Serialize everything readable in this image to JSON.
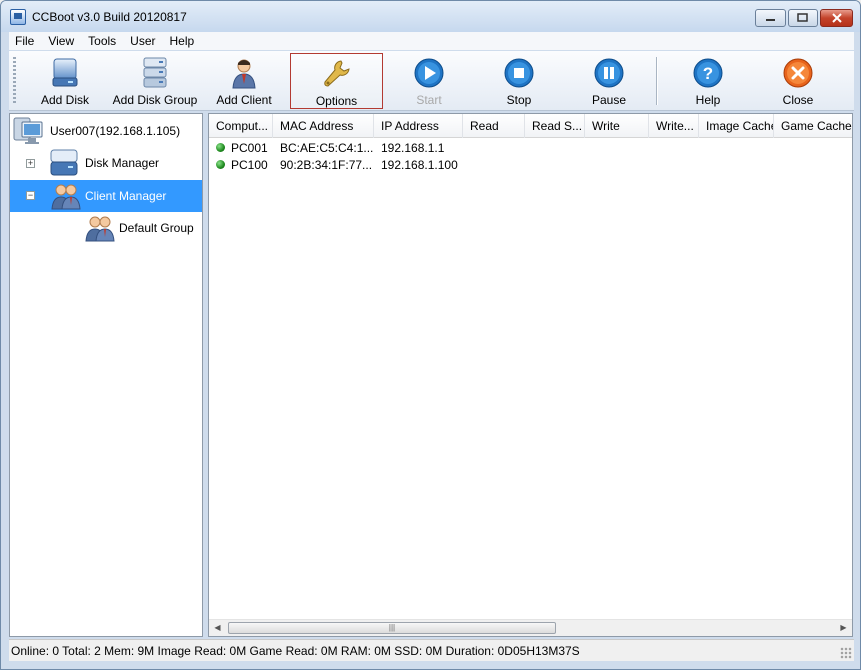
{
  "window": {
    "title": "CCBoot v3.0 Build 20120817"
  },
  "menu": [
    "File",
    "View",
    "Tools",
    "User",
    "Help"
  ],
  "toolbar": {
    "add_disk": "Add Disk",
    "add_disk_group": "Add Disk Group",
    "add_client": "Add Client",
    "options": "Options",
    "start": "Start",
    "stop": "Stop",
    "pause": "Pause",
    "help": "Help",
    "close": "Close"
  },
  "tree": {
    "root": "User007(192.168.1.105)",
    "disk_manager": "Disk Manager",
    "client_manager": "Client Manager",
    "default_group": "Default Group"
  },
  "list": {
    "columns": [
      "Comput...",
      "MAC Address",
      "IP Address",
      "Read",
      "Read S...",
      "Write",
      "Write...",
      "Image Cache",
      "Game Cache"
    ],
    "rows": [
      {
        "computer": "PC001",
        "mac": "BC:AE:C5:C4:1...",
        "ip": "192.168.1.1"
      },
      {
        "computer": "PC100",
        "mac": "90:2B:34:1F:77...",
        "ip": "192.168.1.100"
      }
    ]
  },
  "statusbar": {
    "text": "Online: 0 Total: 2 Mem: 9M Image Read: 0M Game Read: 0M RAM: 0M SSD: 0M Duration: 0D05H13M37S"
  },
  "colors": {
    "selected": "#3399ff",
    "online_status": "#1f8a1f",
    "options_highlight": "#b33a32"
  }
}
